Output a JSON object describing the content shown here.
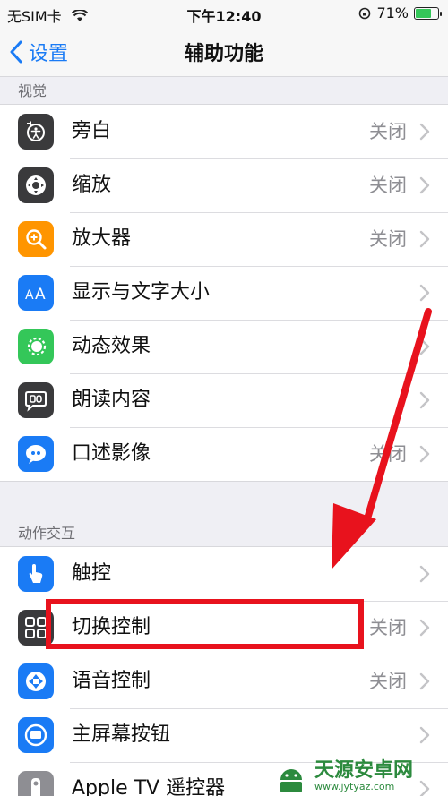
{
  "status_bar": {
    "carrier": "无SIM卡",
    "time": "下午12:40",
    "battery": "71%",
    "battery_fraction": 0.71
  },
  "nav": {
    "back_label": "设置",
    "title": "辅助功能"
  },
  "sections": {
    "vision": "视觉",
    "interaction": "动作交互"
  },
  "vision_items": [
    {
      "label": "旁白",
      "value": "关闭",
      "icon": "voiceover-icon",
      "color": "#3a3a3c"
    },
    {
      "label": "缩放",
      "value": "关闭",
      "icon": "zoom-icon",
      "color": "#3a3a3c"
    },
    {
      "label": "放大器",
      "value": "关闭",
      "icon": "magnifier-icon",
      "color": "#ff9500"
    },
    {
      "label": "显示与文字大小",
      "value": "",
      "icon": "text-size-icon",
      "color": "#1a7bf5"
    },
    {
      "label": "动态效果",
      "value": "",
      "icon": "motion-icon",
      "color": "#34c759"
    },
    {
      "label": "朗读内容",
      "value": "",
      "icon": "speech-icon",
      "color": "#3a3a3c"
    },
    {
      "label": "口述影像",
      "value": "关闭",
      "icon": "audio-description-icon",
      "color": "#1a7bf5"
    }
  ],
  "interaction_items": [
    {
      "label": "触控",
      "value": "",
      "icon": "touch-icon",
      "color": "#1a7bf5"
    },
    {
      "label": "切换控制",
      "value": "关闭",
      "icon": "switch-control-icon",
      "color": "#3a3a3c"
    },
    {
      "label": "语音控制",
      "value": "关闭",
      "icon": "voice-control-icon",
      "color": "#1a7bf5"
    },
    {
      "label": "主屏幕按钮",
      "value": "",
      "icon": "home-button-icon",
      "color": "#1a7bf5"
    },
    {
      "label": "Apple TV 遥控器",
      "value": "",
      "icon": "tv-remote-icon",
      "color": "#8e8e93"
    }
  ],
  "watermark": {
    "name": "天源安卓网",
    "url": "www.jytyaz.com"
  }
}
